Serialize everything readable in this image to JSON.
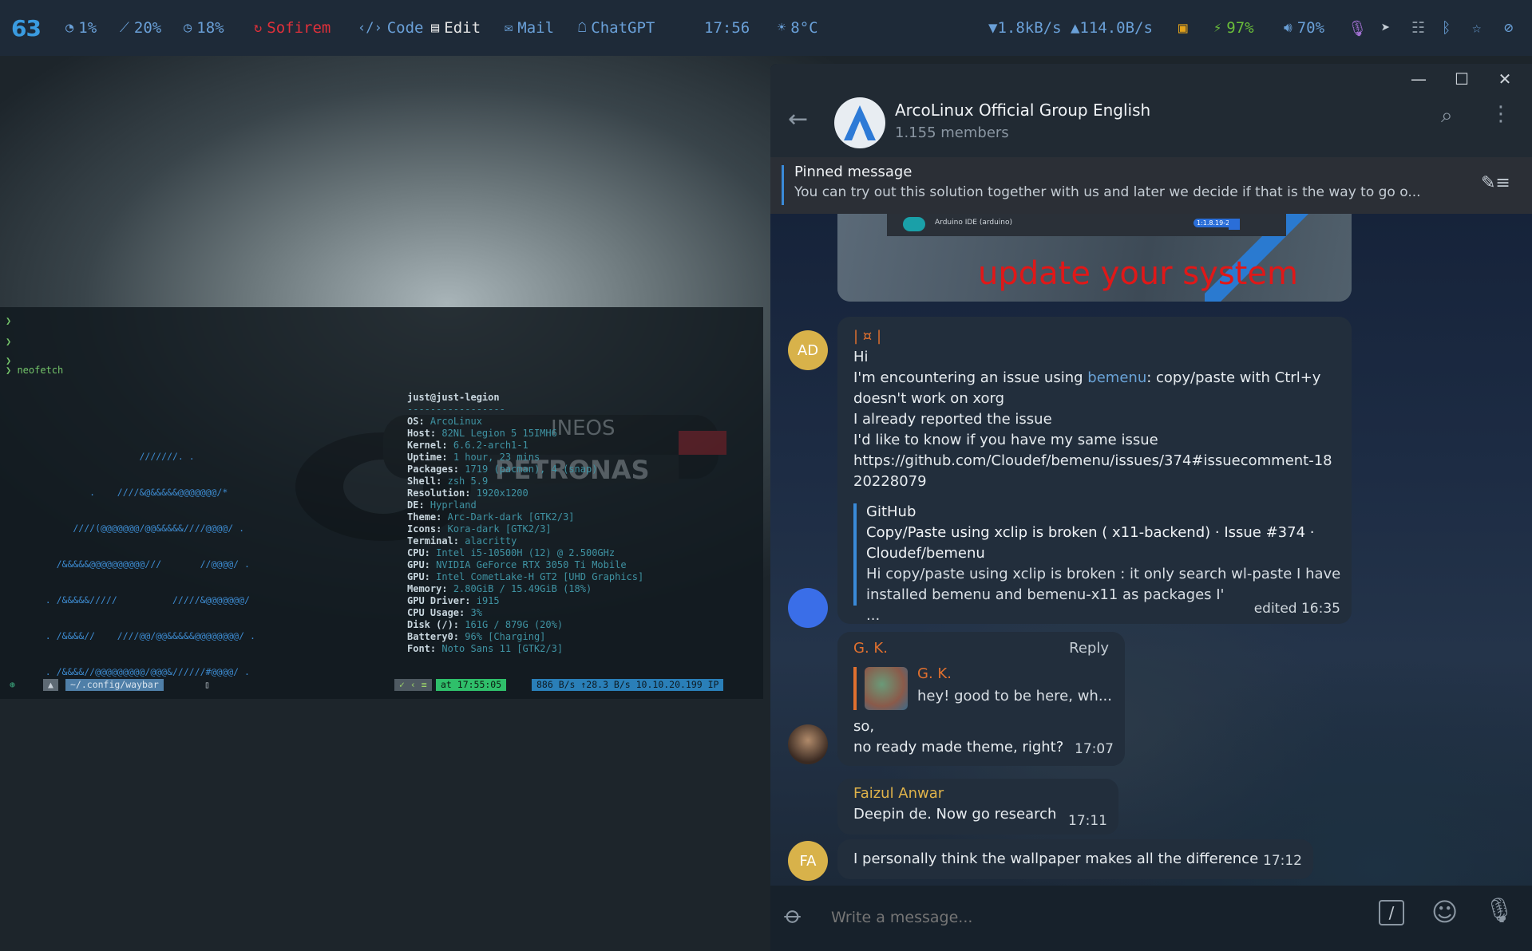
{
  "waybar": {
    "workspace": "63",
    "cpu": "1%",
    "chart": "20%",
    "disk": "18%",
    "app_red": "Sofirem",
    "code": "Code",
    "edit": "Edit",
    "mail": "Mail",
    "chatgpt": "ChatGPT",
    "clock": "17:56",
    "weather": "8°C",
    "network": "▼1.8kB/s ▲114.0B/s",
    "battery": "97%",
    "volume": "70%"
  },
  "terminal": {
    "prompts": [
      "❯",
      "❯",
      "❯",
      "❯ neofetch"
    ],
    "host_header": "just@just-legion",
    "separator": "-----------------",
    "ascii": [
      "                    ///////. .",
      "           .    ////&@&&&&&@@@@@@@/*",
      "        ////(@@@@@@@/@@&&&&&////@@@@/ .",
      "     /&&&&&@@@@@@@@@@///       //@@@@/ .",
      "   . /&&&&&/////          /////&@@@@@@@/",
      "   . /&&&&//    ////@@/@@&&&&&@@@@@@@@/ .",
      "   . /&&&&//@@@@@@@@@/@@@&//////#@@@@/ .",
      "   . /&&&&//@@@@@@@@/          ./*@@@@/ .",
      "     /&&&&///  /@@@@@////&&&&@@/&@@@@/ .",
      "    ./&&&&//////(@@@@@@@@&&&&&@@//@%///",
      "     //&&&&&@@@@@@@@@@@@@@%////.     .",
      "       //&&@@@@////    .",
      "            ."
    ],
    "info": [
      {
        "k": "OS:",
        "v": "ArcoLinux"
      },
      {
        "k": "Host:",
        "v": "82NL Legion 5 15IMH6"
      },
      {
        "k": "Kernel:",
        "v": "6.6.2-arch1-1"
      },
      {
        "k": "Uptime:",
        "v": "1 hour, 23 mins"
      },
      {
        "k": "Packages:",
        "v": "1719 (pacman), 4 (snap)"
      },
      {
        "k": "Shell:",
        "v": "zsh 5.9"
      },
      {
        "k": "Resolution:",
        "v": "1920x1200"
      },
      {
        "k": "DE:",
        "v": "Hyprland"
      },
      {
        "k": "Theme:",
        "v": "Arc-Dark-dark [GTK2/3]"
      },
      {
        "k": "Icons:",
        "v": "Kora-dark [GTK2/3]"
      },
      {
        "k": "Terminal:",
        "v": "alacritty"
      },
      {
        "k": "CPU:",
        "v": "Intel i5-10500H (12) @ 2.500GHz"
      },
      {
        "k": "GPU:",
        "v": "NVIDIA GeForce RTX 3050 Ti Mobile"
      },
      {
        "k": "GPU:",
        "v": "Intel CometLake-H GT2 [UHD Graphics]"
      },
      {
        "k": "Memory:",
        "v": "2.80GiB / 15.49GiB (18%)"
      },
      {
        "k": "GPU Driver:",
        "v": "i915"
      },
      {
        "k": "CPU Usage:",
        "v": "3%"
      },
      {
        "k": "Disk (/):",
        "v": "161G / 879G (20%)"
      },
      {
        "k": "Battery0:",
        "v": "96% [Charging]"
      },
      {
        "k": "Font:",
        "v": "Noto Sans 11 [GTK2/3]"
      }
    ],
    "status": {
      "left": "~/.config/waybar",
      "time": "at 17:55:05",
      "net": "886 B/s  ↑28.3 B/s 10.10.20.199 IP"
    }
  },
  "telegram": {
    "group_name": "ArcoLinux Official Group English",
    "members": "1.155 members",
    "pinned_title": "Pinned message",
    "pinned_text": "You can try out this solution together with us and later we decide if that is the way to go o...",
    "image_caption": "update your system",
    "image_app": "Arduino IDE (arduino)",
    "image_version": "1:1.8.19-2",
    "messages": {
      "ad_avatar": "AD",
      "m1_name": "| ¤ |",
      "m1_lines": [
        "Hi",
        "I'm encountering an issue using",
        "bemenu",
        ": copy/paste with Ctrl+y",
        "doesn't work on xorg",
        "I already reported the issue",
        "I'd like to know if you have my same issue",
        "https://github.com/Cloudef/bemenu/issues/374#issuecomment-18",
        "20228079"
      ],
      "m1_preview_site": "GitHub",
      "m1_preview_title_1": "Copy/Paste using xclip is broken ( x11-backend) · Issue #374 ·",
      "m1_preview_title_2": "Cloudef/bemenu",
      "m1_preview_desc_1": "Hi copy/paste using xclip is broken : it only search wl-paste I have",
      "m1_preview_desc_2": "installed bemenu and bemenu-x11 as packages I' ...",
      "m1_time": "edited 16:35",
      "m2_name": "G. K.",
      "m2_reply_label": "Reply",
      "m2_quote_name": "G. K.",
      "m2_quote_text": "hey! good to be here, wh...",
      "m2_line1": "so,",
      "m2_line2": "no ready made theme, right?",
      "m2_time": "17:07",
      "m3_name": "Faizul Anwar",
      "m3_text": "Deepin de. Now go research",
      "m3_time": "17:11",
      "fa_avatar": "FA",
      "m4_text": "I personally think the wallpaper makes all the difference",
      "m4_time": "17:12"
    },
    "compose_placeholder": "Write a message..."
  },
  "colors": {
    "bar_bg": "#1e2a38",
    "accent_blue": "#3a9be0",
    "tg_header": "#212a33",
    "bubble": "#222e3c",
    "link": "#6aa3d8",
    "name_orange": "#e0702f",
    "name_yellow": "#e0b34a"
  }
}
